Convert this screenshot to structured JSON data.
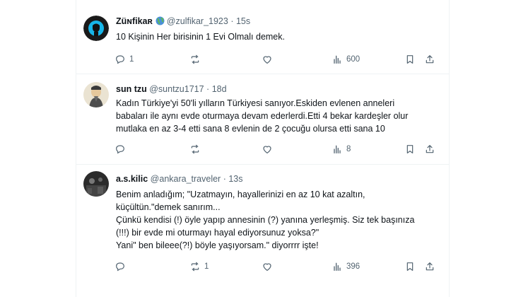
{
  "tweets": [
    {
      "display_name": "Züɴfikaʀ",
      "handle": "@zulfikar_1923",
      "dot": "·",
      "time": "15s",
      "body_lines": [
        "10 Kişinin Her birisinin 1 Evi Olmalı demek."
      ],
      "replies": "1",
      "reposts": "",
      "likes": "",
      "views": "600"
    },
    {
      "display_name": "sun tzu",
      "handle": "@suntzu1717",
      "dot": "·",
      "time": "18d",
      "body_lines": [
        "Kadın Türkiye'yi 50'li yılların Türkiyesi sanıyor.Eskiden evlenen anneleri",
        "babaları ile aynı evde oturmaya devam ederlerdi.Etti 4 bekar kardeşler olur",
        "mutlaka en az 3-4 etti sana 8 evlenin de 2 çocuğu olursa etti sana 10"
      ],
      "replies": "",
      "reposts": "",
      "likes": "",
      "views": "8"
    },
    {
      "display_name": "a.s.kilic",
      "handle": "@ankara_traveler",
      "dot": "·",
      "time": "13s",
      "body_lines": [
        "Benim anladığım; \"Uzatmayın, hayallerinizi en az 10 kat azaltın,",
        "küçültün.\"demek sanırım...",
        "Çünkü kendisi (!) öyle yapıp annesinin (?) yanına yerleşmiş. Siz tek başınıza",
        "(!!!) bir evde mi oturmayı hayal ediyorsunuz yoksa?\"",
        "Yani\" ben bileee(?!) böyle yaşıyorsam.\" diyorrrr işte!"
      ],
      "replies": "",
      "reposts": "1",
      "likes": "",
      "views": "396"
    }
  ],
  "icons": {
    "reply": "reply-icon",
    "repost": "repost-icon",
    "like": "heart-icon",
    "views": "views-icon",
    "bookmark": "bookmark-icon",
    "share": "share-icon",
    "badge": "globe-emoji-icon"
  },
  "colors": {
    "text": "#0f1419",
    "secondary": "#536471",
    "divider": "#eff3f4"
  }
}
